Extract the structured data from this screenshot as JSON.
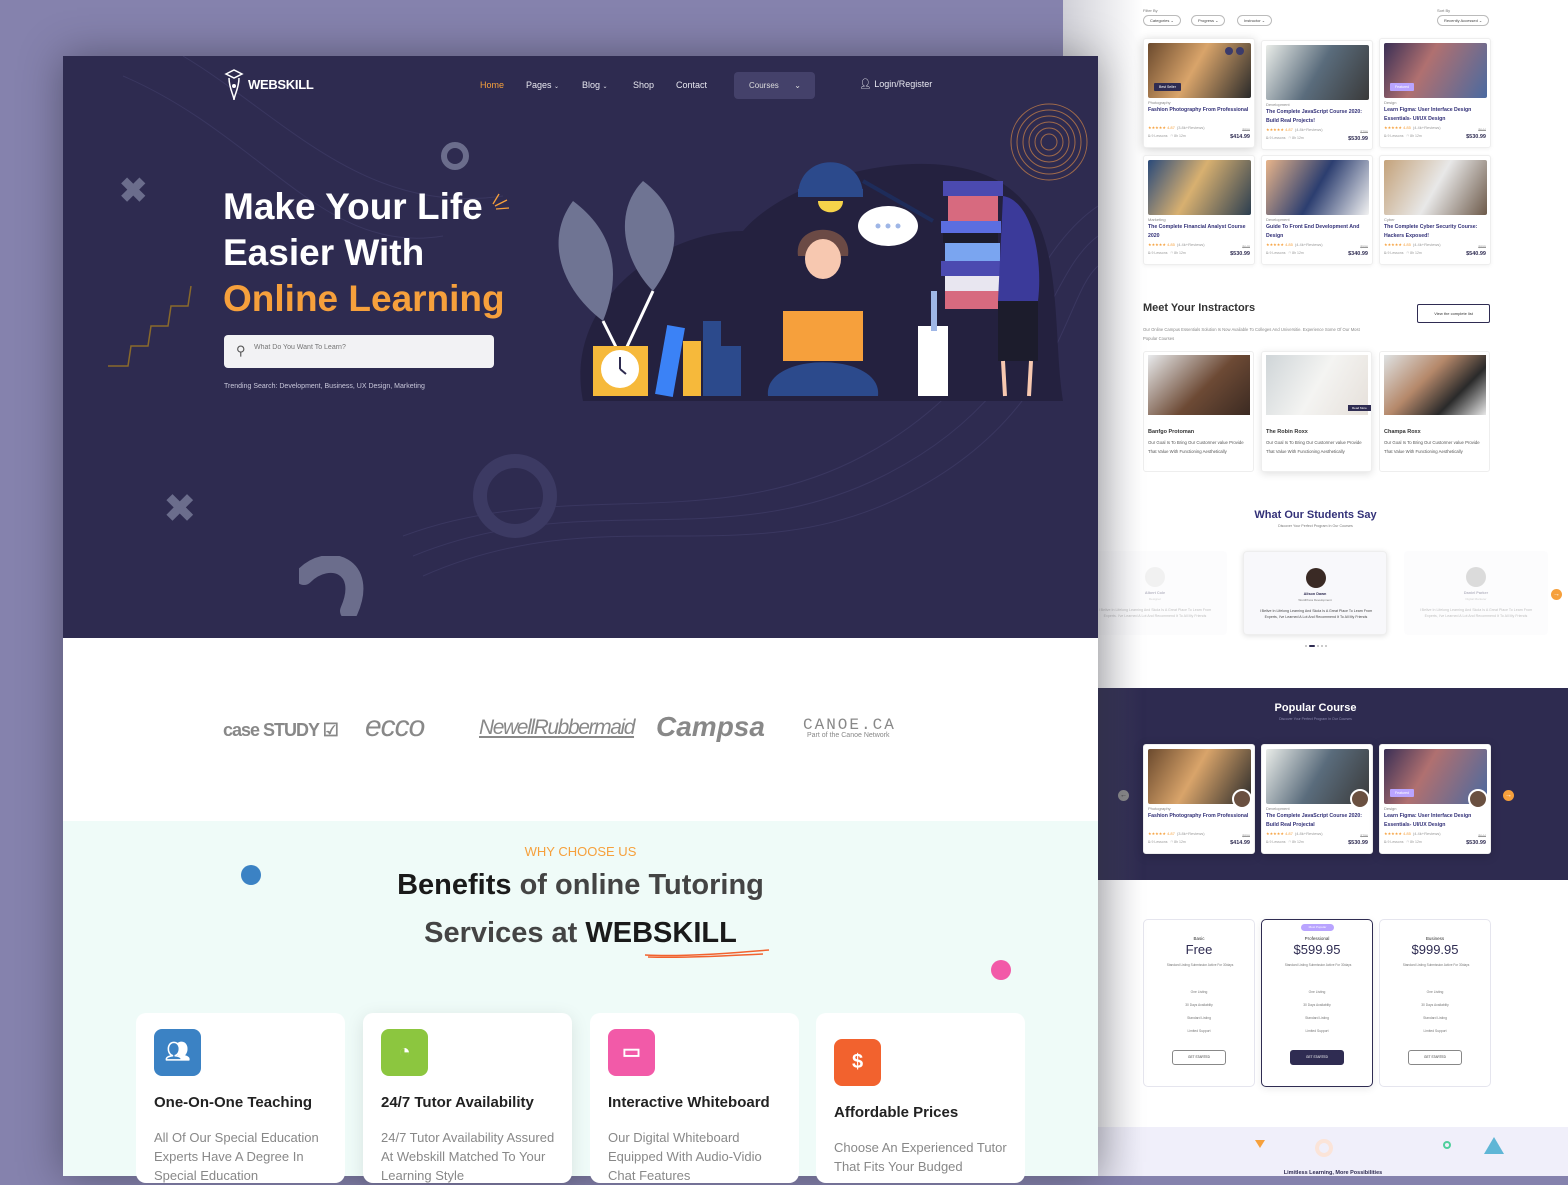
{
  "brand": {
    "name": "WEBSKILL",
    "accent": "#f6a03c",
    "dark": "#2e2b50",
    "bg": "#8582ad"
  },
  "nav": {
    "items": [
      {
        "label": "Home",
        "active": true
      },
      {
        "label": "Pages",
        "dropdown": true
      },
      {
        "label": "Blog",
        "dropdown": true
      },
      {
        "label": "Shop"
      },
      {
        "label": "Contact"
      }
    ],
    "courses_label": "Courses",
    "login_label": "Login/Register"
  },
  "hero": {
    "line1": "Make Your Life",
    "line2": "Easier With",
    "line3": "Online Learning",
    "search_placeholder": "What Do You Want To Learn?",
    "trending": "Trending Search: Development, Business, UX Design, Marketing"
  },
  "partners": [
    "case STUDY",
    "ecco",
    "NewellRubbermaid",
    "Campsa",
    "CANOE.CA"
  ],
  "partner_sub": "Part of the Canoe Network",
  "why": {
    "eyebrow": "WHY CHOOSE US",
    "title_a": "Benefits",
    "title_b": " of online Tutoring",
    "title_c": "Services at ",
    "title_d": "WEBSKILL",
    "features": [
      {
        "title": "One-On-One Teaching",
        "desc": "All Of Our Special Education Experts Have A Degree In Special Education",
        "icon": "users-icon",
        "color": "#3b82c4"
      },
      {
        "title": "24/7 Tutor Availability",
        "desc": "24/7 Tutor Availability Assured At Webskill Matched To Your Learning Style",
        "icon": "clock-icon",
        "color": "#8cc63f"
      },
      {
        "title": "Interactive Whiteboard",
        "desc": "Our Digital Whiteboard Equipped With Audio-Vidio Chat Features",
        "icon": "calendar-icon",
        "color": "#f25aa8"
      },
      {
        "title": "Affordable Prices",
        "desc": "Choose An Experienced Tutor That Fits Your Budged",
        "icon": "dollar-icon",
        "color": "#f2622e"
      }
    ]
  },
  "filters": {
    "filter_label": "Filter By",
    "sort_label": "Sort By",
    "options": [
      "Categories",
      "Progress",
      "Instructor"
    ],
    "sort_value": "Recently Accessed"
  },
  "courses": [
    {
      "category": "Photography",
      "title": "Fashion Photography From Professional",
      "rating": "4.87",
      "reviews": "(3.8k+Reviews)",
      "old_price": "$859",
      "price": "$414.99",
      "badge": "Best Seller",
      "lessons": "9 Lessons",
      "duration": "8h 12m"
    },
    {
      "category": "Development",
      "title": "The Complete JavaScript Course 2020: Build Real Projects!",
      "rating": "4.87",
      "reviews": "(4.8k+Reviews)",
      "old_price": "$756",
      "price": "$530.99",
      "lessons": "9 Lessons",
      "duration": "8h 12m"
    },
    {
      "category": "Design",
      "title": "Learn Figma: User Interface Design Essentials- UI/UX Design",
      "rating": "4.85",
      "reviews": "(4.4k+Reviews)",
      "old_price": "$644",
      "price": "$530.99",
      "badge": "Featured",
      "lessons": "9 Lessons",
      "duration": "8h 12m"
    },
    {
      "category": "Marketing",
      "title": "The Complete Financial Analyst Course 2020",
      "rating": "4.85",
      "reviews": "(4.4k+Reviews)",
      "old_price": "$648",
      "price": "$530.99",
      "lessons": "9 Lessons",
      "duration": "8h 12m"
    },
    {
      "category": "Development",
      "title": "Guide To Front End Development And Design",
      "rating": "4.85",
      "reviews": "(4.4k+Reviews)",
      "old_price": "$556",
      "price": "$340.99",
      "lessons": "9 Lessons",
      "duration": "8h 12m"
    },
    {
      "category": "Cyber",
      "title": "The Complete Cyber Security Course: Hackers Exposed!",
      "rating": "4.85",
      "reviews": "(4.4k+Reviews)",
      "old_price": "$855",
      "price": "$540.99",
      "lessons": "9 Lessons",
      "duration": "8h 12m"
    }
  ],
  "instructors": {
    "title": "Meet Your Instractors",
    "subtitle": "Our Online Campus Essentials Solution Is Now Available To Colleges And Universitie. Experience Some Of Our Most Popular Courses",
    "view_all": "View the complete list",
    "read_more": "Read More",
    "list": [
      {
        "name": "Banfgo Protoman",
        "desc": "Our Goal Is To Bring Our Custormer value Provide That Value With Functioning Aesthetically"
      },
      {
        "name": "The Robin Roxx",
        "desc": "Our Goal Is To Bring Our Custormer value Provide That Value With Functioning Aesthetically"
      },
      {
        "name": "Champa Roxx",
        "desc": "Our Goal Is To Bring Our Custormer value Provide That Value With Functioning Aesthetically"
      }
    ]
  },
  "testimonials": {
    "title": "What Our Students Say",
    "subtitle": "Discover Your Perfect Program In Our Courses",
    "list": [
      {
        "name": "Albert Cole",
        "role": "Designer",
        "quote": "I Belive In Lifelong Learning And Skola Is A Great Place To Learn From Experts. I've Learned A Lot And Recommend It To All My Friends"
      },
      {
        "name": "Alison Dawn",
        "role": "WordPress Development",
        "quote": "I Belive In Lifelong Learning And Skola Is A Great Place To Learn From Experts, I've Learned A Lot And Recommend It To All My Friends"
      },
      {
        "name": "Daniel Parker",
        "role": "Digital Marketer",
        "quote": "I Belive In Lifelong Learning And Skola Is A Great Place To Learn From Experts, I've Learned A Lot And Recommend It To All My Friends"
      }
    ]
  },
  "popular": {
    "title": "Popular Course",
    "subtitle": "Discover Your Perfect Program In Our Courses",
    "list": [
      {
        "category": "Photography",
        "title": "Fashion Photography From Professional",
        "rating": "4.87",
        "reviews": "(3.8k+Reviews)",
        "old_price": "$859",
        "price": "$414.99",
        "lessons": "9 Lessons",
        "duration": "8h 12m"
      },
      {
        "category": "Development",
        "title": "The Complete JavaScript Course 2020: Build Real Projectal",
        "rating": "4.87",
        "reviews": "(4.8k+Reviews)",
        "old_price": "$756",
        "price": "$530.99",
        "lessons": "9 Lessons",
        "duration": "8h 12m"
      },
      {
        "category": "Design",
        "title": "Learn Figma: User Interface Design Essentials- UI/UX Design",
        "rating": "4.85",
        "reviews": "(4.4k+Reviews)",
        "old_price": "$644",
        "price": "$530.99",
        "badge": "Featured",
        "lessons": "9 Lessons",
        "duration": "8h 12m"
      }
    ]
  },
  "pricing": [
    {
      "tier": "Basic",
      "price": "Free",
      "desc": "Standard Listing Submission Active For 30days",
      "features": [
        "One Listing",
        "30 Days Availabilty",
        "Standard Listing",
        "Limited Support"
      ],
      "cta": "GET STARTED"
    },
    {
      "tier": "Professional",
      "price": "$599.95",
      "desc": "Standard Listing Submission Active For 30days",
      "features": [
        "One Listing",
        "30 Days Availabilty",
        "Standard Listing",
        "Limited Support"
      ],
      "cta": "GET STARTED",
      "badge": "Most Popular"
    },
    {
      "tier": "Business",
      "price": "$999.95",
      "desc": "Standard Listing Submission Active For 30days",
      "features": [
        "One Listing",
        "30 Days Availabilty",
        "Standard Listing",
        "Limited Support"
      ],
      "cta": "GET STARTED"
    }
  ],
  "footer_banner": "Limitless Learning, More Possibilities"
}
